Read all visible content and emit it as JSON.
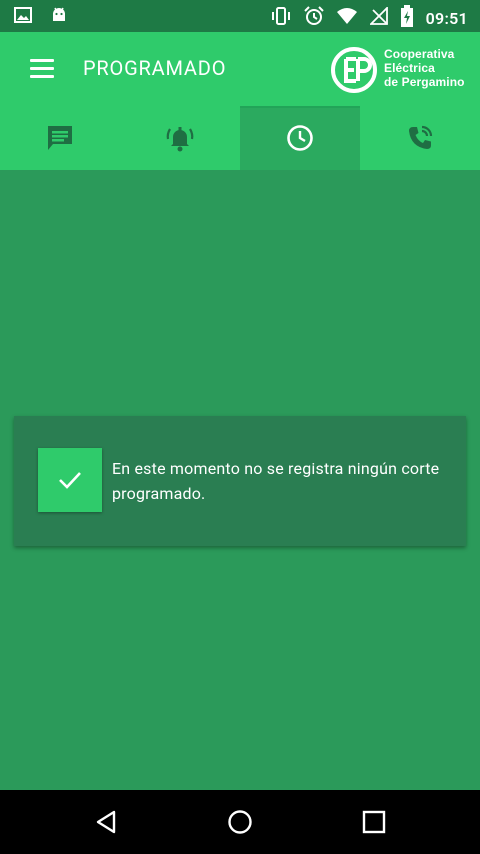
{
  "status_bar": {
    "time": "09:51",
    "icons": [
      "image-notification-icon",
      "android-notification-icon",
      "vibrate-icon",
      "alarm-icon",
      "wifi-icon",
      "no-signal-icon",
      "battery-charging-icon"
    ]
  },
  "app_bar": {
    "title": "PROGRAMADO",
    "menu_icon": "hamburger-menu-icon",
    "logo": {
      "line1": "Cooperativa",
      "line2": "Eléctrica",
      "line3": "de Pergamino"
    }
  },
  "tabs": [
    {
      "name": "messages",
      "icon": "chat-icon",
      "active": false
    },
    {
      "name": "alerts",
      "icon": "alarm-bell-icon",
      "active": false
    },
    {
      "name": "scheduled",
      "icon": "clock-icon",
      "active": true
    },
    {
      "name": "calls",
      "icon": "phone-call-icon",
      "active": false
    }
  ],
  "notice": {
    "icon": "check-icon",
    "message": "En este momento no se registra ningún corte programado."
  },
  "nav_bar": {
    "buttons": [
      "back-icon",
      "home-icon",
      "recents-icon"
    ]
  },
  "colors": {
    "status_bar": "#1e7a45",
    "app_bar": "#2fcb6b",
    "background": "#2b9a5a",
    "card": "#2a7e52",
    "tab_icon": "#1f6e43"
  }
}
